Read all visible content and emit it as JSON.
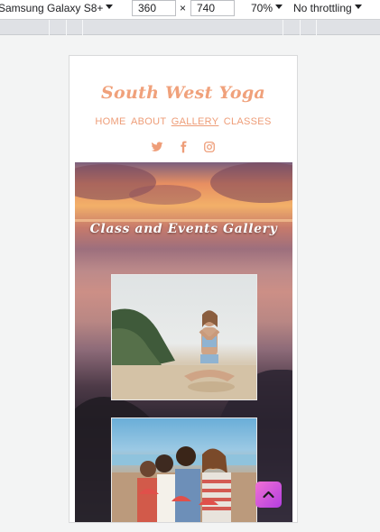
{
  "devtools": {
    "device": "Samsung Galaxy S8+",
    "width": "360",
    "times": "×",
    "height": "740",
    "zoom": "70%",
    "throttling": "No throttling"
  },
  "site": {
    "brand": "South West Yoga",
    "nav": [
      "HOME",
      "ABOUT",
      "GALLERY",
      "CLASSES"
    ],
    "active_nav": "GALLERY",
    "social_icons": [
      "twitter-icon",
      "facebook-icon",
      "instagram-icon"
    ],
    "accent_color": "#f0a17b"
  },
  "gallery": {
    "title": "Class and Events Gallery",
    "photos": [
      {
        "name": "woman-meditating-on-beach"
      },
      {
        "name": "friends-eating-watermelon-on-beach"
      }
    ]
  },
  "scroll_button": {
    "icon": "chevron-up-icon"
  }
}
